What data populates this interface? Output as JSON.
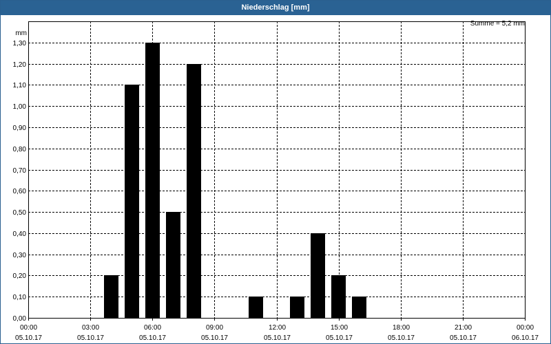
{
  "window": {
    "title": "Niederschlag [mm]"
  },
  "chart_data": {
    "type": "bar",
    "ylabel": "mm",
    "sum_label": "Summe = 5,2 mm",
    "ylim": [
      0,
      1.4
    ],
    "y_ticks": [
      0,
      0.1,
      0.2,
      0.3,
      0.4,
      0.5,
      0.6,
      0.7,
      0.8,
      0.9,
      1.0,
      1.1,
      1.2,
      1.3
    ],
    "y_tick_labels": [
      "0,00",
      "0,10",
      "0,20",
      "0,30",
      "0,40",
      "0,50",
      "0,60",
      "0,70",
      "0,80",
      "0,90",
      "1,00",
      "1,10",
      "1,20",
      "1,30"
    ],
    "x_range_hours": [
      0,
      24
    ],
    "x_ticks": [
      {
        "hour": 0,
        "time": "00:00",
        "date": "05.10.17"
      },
      {
        "hour": 3,
        "time": "03:00",
        "date": "05.10.17"
      },
      {
        "hour": 6,
        "time": "06:00",
        "date": "05.10.17"
      },
      {
        "hour": 9,
        "time": "09:00",
        "date": "05.10.17"
      },
      {
        "hour": 12,
        "time": "12:00",
        "date": "05.10.17"
      },
      {
        "hour": 15,
        "time": "15:00",
        "date": "05.10.17"
      },
      {
        "hour": 18,
        "time": "18:00",
        "date": "05.10.17"
      },
      {
        "hour": 21,
        "time": "21:00",
        "date": "05.10.17"
      },
      {
        "hour": 24,
        "time": "00:00",
        "date": "06.10.17"
      }
    ],
    "bars": [
      {
        "hour": 4,
        "value": 0.2
      },
      {
        "hour": 5,
        "value": 1.1
      },
      {
        "hour": 6,
        "value": 1.3
      },
      {
        "hour": 7,
        "value": 0.5
      },
      {
        "hour": 8,
        "value": 1.2
      },
      {
        "hour": 11,
        "value": 0.1
      },
      {
        "hour": 13,
        "value": 0.1
      },
      {
        "hour": 14,
        "value": 0.4
      },
      {
        "hour": 15,
        "value": 0.2
      },
      {
        "hour": 16,
        "value": 0.1
      }
    ],
    "colors": {
      "bar": "#000000",
      "grid": "#000000",
      "title_bar": "#2a6293"
    },
    "grid": true
  }
}
